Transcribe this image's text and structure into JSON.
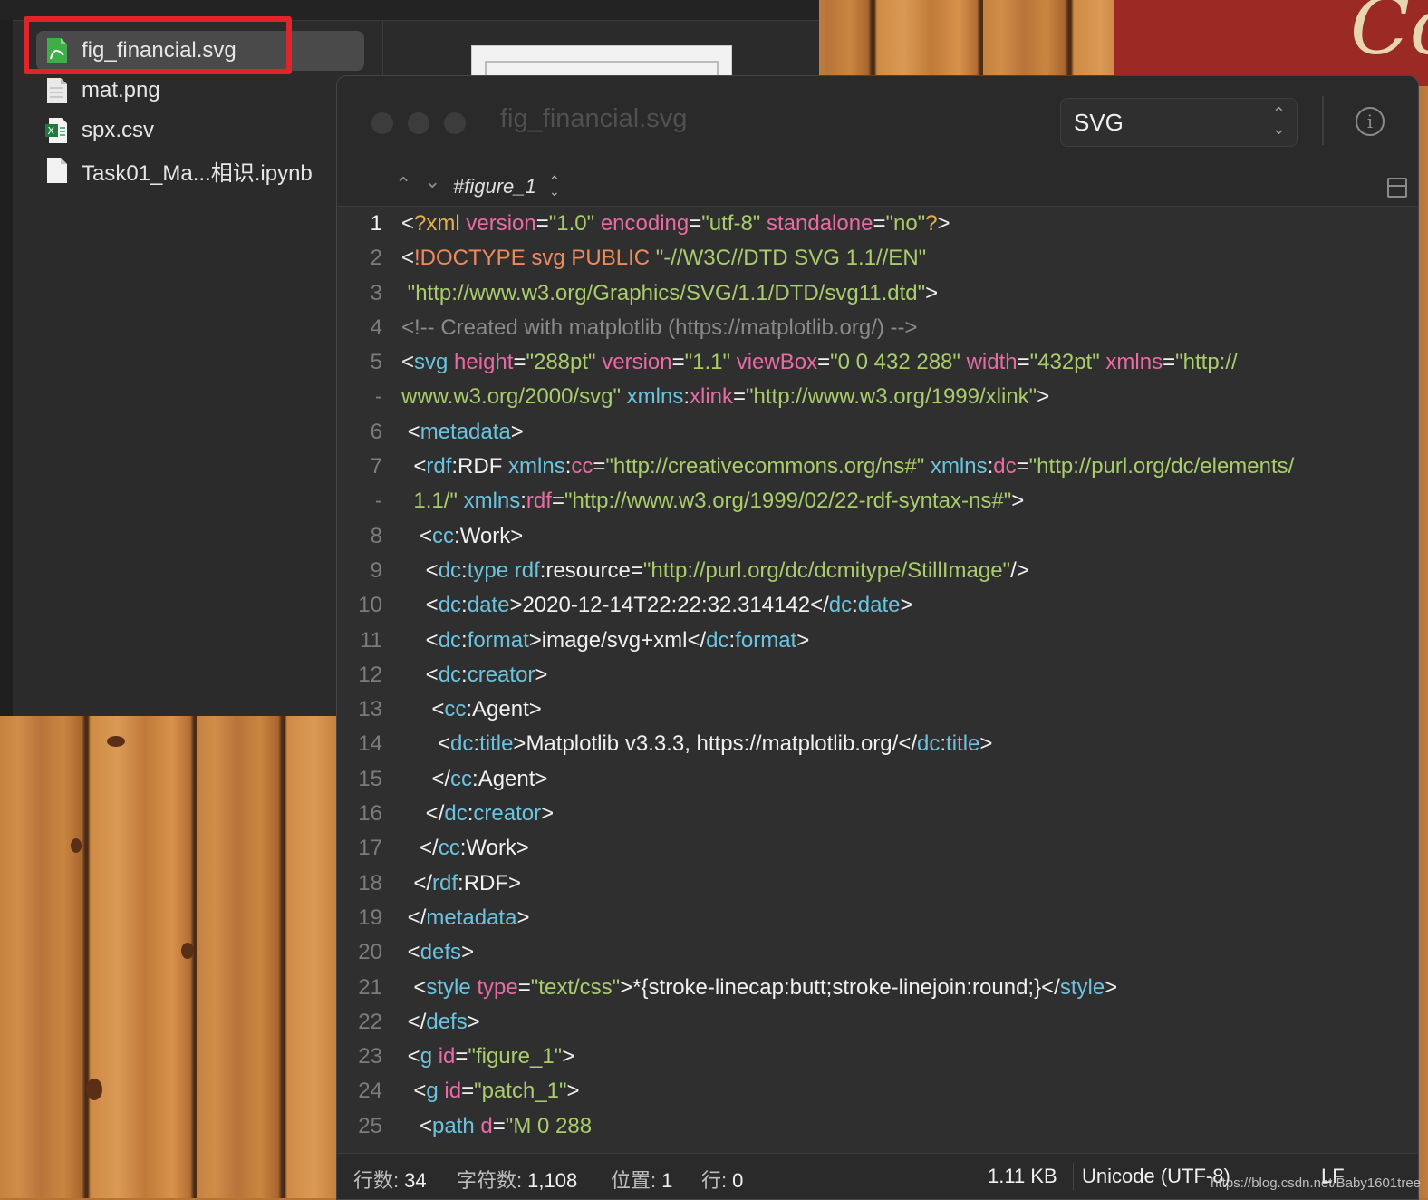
{
  "finder": {
    "files": [
      {
        "name": "fig_financial.svg",
        "icon": "svg-file-icon",
        "selected": true
      },
      {
        "name": "mat.png",
        "icon": "png-file-icon",
        "selected": false
      },
      {
        "name": "spx.csv",
        "icon": "csv-excel-file-icon",
        "selected": false
      },
      {
        "name": "Task01_Ma...相识.ipynb",
        "icon": "document-file-icon",
        "selected": false
      }
    ]
  },
  "editor": {
    "window_title": "fig_financial.svg",
    "format_select": "SVG",
    "symbol_path": "#figure_1",
    "lines": [
      {
        "n": "1",
        "current": true,
        "segs": [
          [
            "p",
            "<"
          ],
          [
            "pi",
            "?xml"
          ],
          [
            "t",
            " "
          ],
          [
            "a",
            "version"
          ],
          [
            "p",
            "="
          ],
          [
            "s",
            "\"1.0\""
          ],
          [
            "t",
            " "
          ],
          [
            "a",
            "encoding"
          ],
          [
            "p",
            "="
          ],
          [
            "s",
            "\"utf-8\""
          ],
          [
            "t",
            " "
          ],
          [
            "a",
            "standalone"
          ],
          [
            "p",
            "="
          ],
          [
            "s",
            "\"no\""
          ],
          [
            "pi",
            "?"
          ],
          [
            "p",
            ">"
          ]
        ]
      },
      {
        "n": "2",
        "segs": [
          [
            "p",
            "<"
          ],
          [
            "k",
            "!DOCTYPE svg PUBLIC "
          ],
          [
            "s",
            "\"-//W3C//DTD SVG 1.1//EN\""
          ]
        ]
      },
      {
        "n": "3",
        "segs": [
          [
            "t",
            " "
          ],
          [
            "s",
            "\"http://www.w3.org/Graphics/SVG/1.1/DTD/svg11.dtd\""
          ],
          [
            "p",
            ">"
          ]
        ]
      },
      {
        "n": "4",
        "segs": [
          [
            "c",
            "<!-- Created with matplotlib (https://matplotlib.org/) -->"
          ]
        ]
      },
      {
        "n": "5",
        "segs": [
          [
            "p",
            "<"
          ],
          [
            "g",
            "svg"
          ],
          [
            "t",
            " "
          ],
          [
            "a",
            "height"
          ],
          [
            "p",
            "="
          ],
          [
            "s",
            "\"288pt\""
          ],
          [
            "t",
            " "
          ],
          [
            "a",
            "version"
          ],
          [
            "p",
            "="
          ],
          [
            "s",
            "\"1.1\""
          ],
          [
            "t",
            " "
          ],
          [
            "a",
            "viewBox"
          ],
          [
            "p",
            "="
          ],
          [
            "s",
            "\"0 0 432 288\""
          ],
          [
            "t",
            " "
          ],
          [
            "a",
            "width"
          ],
          [
            "p",
            "="
          ],
          [
            "s",
            "\"432pt\""
          ],
          [
            "t",
            " "
          ],
          [
            "a",
            "xmlns"
          ],
          [
            "p",
            "="
          ],
          [
            "s",
            "\"http://"
          ]
        ]
      },
      {
        "n": "-",
        "segs": [
          [
            "s",
            "www.w3.org/2000/svg\""
          ],
          [
            "t",
            " "
          ],
          [
            "g",
            "xmlns"
          ],
          [
            "p",
            ":"
          ],
          [
            "a",
            "xlink"
          ],
          [
            "p",
            "="
          ],
          [
            "s",
            "\"http://www.w3.org/1999/xlink\""
          ],
          [
            "p",
            ">"
          ]
        ]
      },
      {
        "n": "6",
        "segs": [
          [
            "t",
            " "
          ],
          [
            "p",
            "<"
          ],
          [
            "g",
            "metadata"
          ],
          [
            "p",
            ">"
          ]
        ]
      },
      {
        "n": "7",
        "segs": [
          [
            "t",
            "  "
          ],
          [
            "p",
            "<"
          ],
          [
            "g",
            "rdf"
          ],
          [
            "p",
            ":RDF "
          ],
          [
            "g",
            "xmlns"
          ],
          [
            "p",
            ":"
          ],
          [
            "a",
            "cc"
          ],
          [
            "p",
            "="
          ],
          [
            "s",
            "\"http://creativecommons.org/ns#\""
          ],
          [
            "t",
            " "
          ],
          [
            "g",
            "xmlns"
          ],
          [
            "p",
            ":"
          ],
          [
            "a",
            "dc"
          ],
          [
            "p",
            "="
          ],
          [
            "s",
            "\"http://purl.org/dc/elements/"
          ]
        ]
      },
      {
        "n": "-",
        "segs": [
          [
            "t",
            "  "
          ],
          [
            "s",
            "1.1/\""
          ],
          [
            "t",
            " "
          ],
          [
            "g",
            "xmlns"
          ],
          [
            "p",
            ":"
          ],
          [
            "a",
            "rdf"
          ],
          [
            "p",
            "="
          ],
          [
            "s",
            "\"http://www.w3.org/1999/02/22-rdf-syntax-ns#\""
          ],
          [
            "p",
            ">"
          ]
        ]
      },
      {
        "n": "8",
        "segs": [
          [
            "t",
            "   "
          ],
          [
            "p",
            "<"
          ],
          [
            "g",
            "cc"
          ],
          [
            "p",
            ":Work>"
          ]
        ]
      },
      {
        "n": "9",
        "segs": [
          [
            "t",
            "    "
          ],
          [
            "p",
            "<"
          ],
          [
            "g",
            "dc"
          ],
          [
            "p",
            ":"
          ],
          [
            "g",
            "type"
          ],
          [
            "t",
            " "
          ],
          [
            "g",
            "rdf"
          ],
          [
            "p",
            ":resource="
          ],
          [
            "s",
            "\"http://purl.org/dc/dcmitype/StillImage\""
          ],
          [
            "p",
            "/>"
          ]
        ]
      },
      {
        "n": "10",
        "segs": [
          [
            "t",
            "    "
          ],
          [
            "p",
            "<"
          ],
          [
            "g",
            "dc"
          ],
          [
            "p",
            ":"
          ],
          [
            "g",
            "date"
          ],
          [
            "p",
            ">"
          ],
          [
            "t",
            "2020-12-14T22:22:32.314142"
          ],
          [
            "p",
            "</"
          ],
          [
            "g",
            "dc"
          ],
          [
            "p",
            ":"
          ],
          [
            "g",
            "date"
          ],
          [
            "p",
            ">"
          ]
        ]
      },
      {
        "n": "11",
        "segs": [
          [
            "t",
            "    "
          ],
          [
            "p",
            "<"
          ],
          [
            "g",
            "dc"
          ],
          [
            "p",
            ":"
          ],
          [
            "g",
            "format"
          ],
          [
            "p",
            ">"
          ],
          [
            "t",
            "image/svg+xml"
          ],
          [
            "p",
            "</"
          ],
          [
            "g",
            "dc"
          ],
          [
            "p",
            ":"
          ],
          [
            "g",
            "format"
          ],
          [
            "p",
            ">"
          ]
        ]
      },
      {
        "n": "12",
        "segs": [
          [
            "t",
            "    "
          ],
          [
            "p",
            "<"
          ],
          [
            "g",
            "dc"
          ],
          [
            "p",
            ":"
          ],
          [
            "g",
            "creator"
          ],
          [
            "p",
            ">"
          ]
        ]
      },
      {
        "n": "13",
        "segs": [
          [
            "t",
            "     "
          ],
          [
            "p",
            "<"
          ],
          [
            "g",
            "cc"
          ],
          [
            "p",
            ":Agent>"
          ]
        ]
      },
      {
        "n": "14",
        "segs": [
          [
            "t",
            "      "
          ],
          [
            "p",
            "<"
          ],
          [
            "g",
            "dc"
          ],
          [
            "p",
            ":"
          ],
          [
            "g",
            "title"
          ],
          [
            "p",
            ">"
          ],
          [
            "t",
            "Matplotlib v3.3.3, https://matplotlib.org/"
          ],
          [
            "p",
            "</"
          ],
          [
            "g",
            "dc"
          ],
          [
            "p",
            ":"
          ],
          [
            "g",
            "title"
          ],
          [
            "p",
            ">"
          ]
        ]
      },
      {
        "n": "15",
        "segs": [
          [
            "t",
            "     "
          ],
          [
            "p",
            "</"
          ],
          [
            "g",
            "cc"
          ],
          [
            "p",
            ":Agent>"
          ]
        ]
      },
      {
        "n": "16",
        "segs": [
          [
            "t",
            "    "
          ],
          [
            "p",
            "</"
          ],
          [
            "g",
            "dc"
          ],
          [
            "p",
            ":"
          ],
          [
            "g",
            "creator"
          ],
          [
            "p",
            ">"
          ]
        ]
      },
      {
        "n": "17",
        "segs": [
          [
            "t",
            "   "
          ],
          [
            "p",
            "</"
          ],
          [
            "g",
            "cc"
          ],
          [
            "p",
            ":Work>"
          ]
        ]
      },
      {
        "n": "18",
        "segs": [
          [
            "t",
            "  "
          ],
          [
            "p",
            "</"
          ],
          [
            "g",
            "rdf"
          ],
          [
            "p",
            ":RDF>"
          ]
        ]
      },
      {
        "n": "19",
        "segs": [
          [
            "t",
            " "
          ],
          [
            "p",
            "</"
          ],
          [
            "g",
            "metadata"
          ],
          [
            "p",
            ">"
          ]
        ]
      },
      {
        "n": "20",
        "segs": [
          [
            "t",
            " "
          ],
          [
            "p",
            "<"
          ],
          [
            "g",
            "defs"
          ],
          [
            "p",
            ">"
          ]
        ]
      },
      {
        "n": "21",
        "segs": [
          [
            "t",
            "  "
          ],
          [
            "p",
            "<"
          ],
          [
            "g",
            "style"
          ],
          [
            "t",
            " "
          ],
          [
            "a",
            "type"
          ],
          [
            "p",
            "="
          ],
          [
            "s",
            "\"text/css\""
          ],
          [
            "p",
            ">"
          ],
          [
            "t",
            "*{stroke-linecap:butt;stroke-linejoin:round;}"
          ],
          [
            "p",
            "</"
          ],
          [
            "g",
            "style"
          ],
          [
            "p",
            ">"
          ]
        ]
      },
      {
        "n": "22",
        "segs": [
          [
            "t",
            " "
          ],
          [
            "p",
            "</"
          ],
          [
            "g",
            "defs"
          ],
          [
            "p",
            ">"
          ]
        ]
      },
      {
        "n": "23",
        "segs": [
          [
            "t",
            " "
          ],
          [
            "p",
            "<"
          ],
          [
            "g",
            "g"
          ],
          [
            "t",
            " "
          ],
          [
            "a",
            "id"
          ],
          [
            "p",
            "="
          ],
          [
            "s",
            "\"figure_1\""
          ],
          [
            "p",
            ">"
          ]
        ]
      },
      {
        "n": "24",
        "segs": [
          [
            "t",
            "  "
          ],
          [
            "p",
            "<"
          ],
          [
            "g",
            "g"
          ],
          [
            "t",
            " "
          ],
          [
            "a",
            "id"
          ],
          [
            "p",
            "="
          ],
          [
            "s",
            "\"patch_1\""
          ],
          [
            "p",
            ">"
          ]
        ]
      },
      {
        "n": "25",
        "segs": [
          [
            "t",
            "   "
          ],
          [
            "p",
            "<"
          ],
          [
            "g",
            "path"
          ],
          [
            "t",
            " "
          ],
          [
            "a",
            "d"
          ],
          [
            "p",
            "="
          ],
          [
            "s",
            "\"M 0 288"
          ]
        ]
      }
    ],
    "status": {
      "lines_label": "行数:",
      "lines_value": "34",
      "chars_label": "字符数:",
      "chars_value": "1,108",
      "pos_label": "位置:",
      "pos_value": "1",
      "row_label": "行:",
      "row_value": "0",
      "size": "1.11 KB",
      "encoding": "Unicode (UTF-8)",
      "line_ending": "LF"
    }
  },
  "watermark": "https://blog.csdn.net/Baby1601tree"
}
